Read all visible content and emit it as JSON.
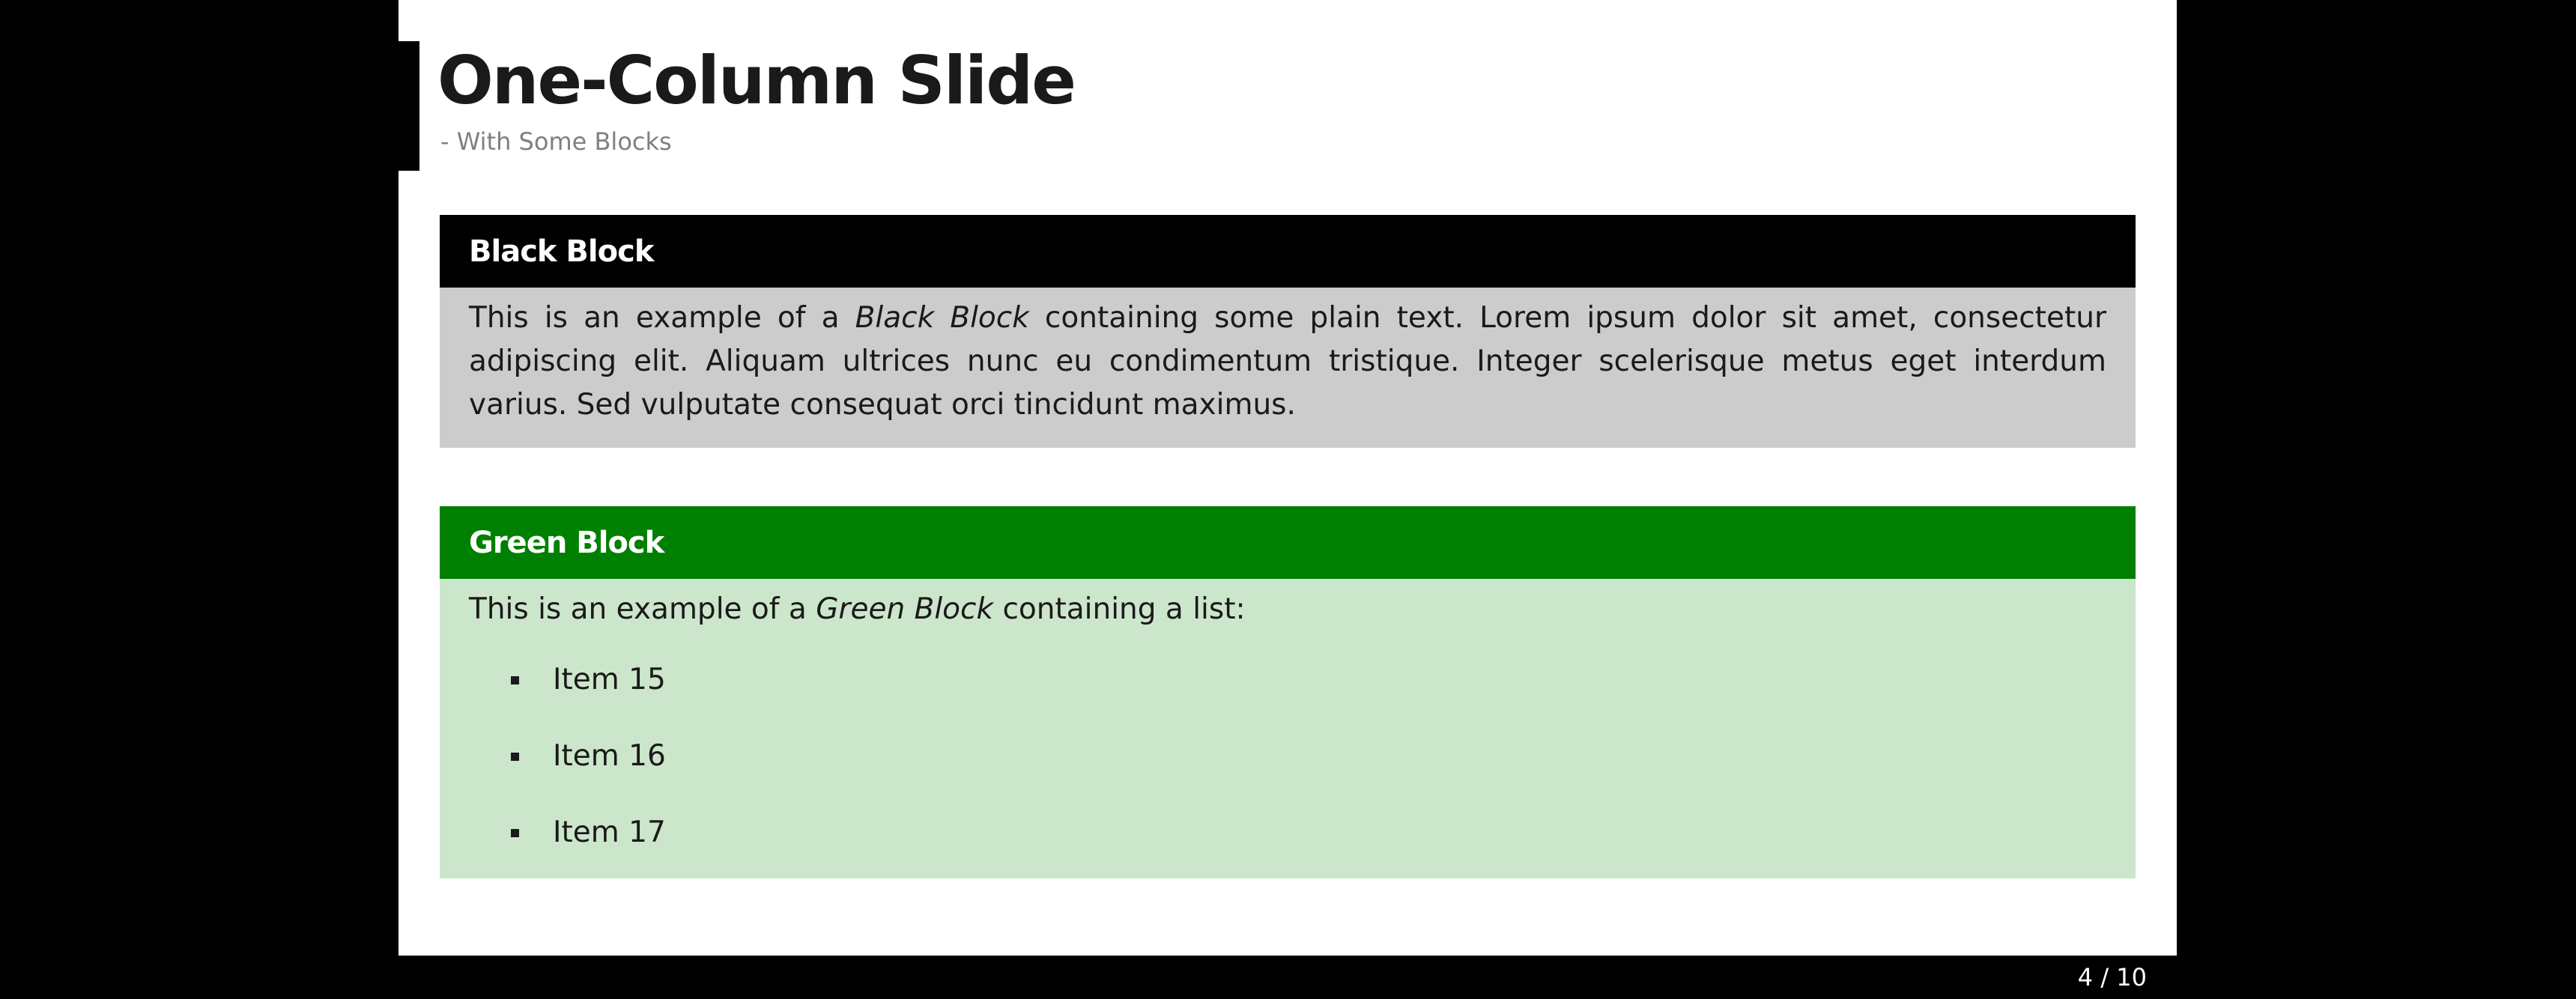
{
  "slide": {
    "title": "One-Column Slide",
    "subtitle": "- With Some Blocks"
  },
  "black_block": {
    "title": "Black Block",
    "text_before": "This is an example of a ",
    "text_emphasis": "Black Block",
    "text_after": " containing some plain text. Lorem ipsum dolor sit amet, consectetur adipiscing elit. Aliquam ultrices nunc eu condimentum tristique. Integer scelerisque metus eget interdum varius. Sed vulputate consequat orci tincidunt maximus.",
    "header_color": "#000000",
    "body_color": "#cccccc"
  },
  "green_block": {
    "title": "Green Block",
    "text_before": "This is an example of a ",
    "text_emphasis": "Green Block",
    "text_after": " containing a list:",
    "items": [
      "Item 15",
      "Item 16",
      "Item 17"
    ],
    "header_color": "#008000",
    "body_color": "#cce6cc"
  },
  "footer": {
    "page_number": "4 / 10"
  }
}
